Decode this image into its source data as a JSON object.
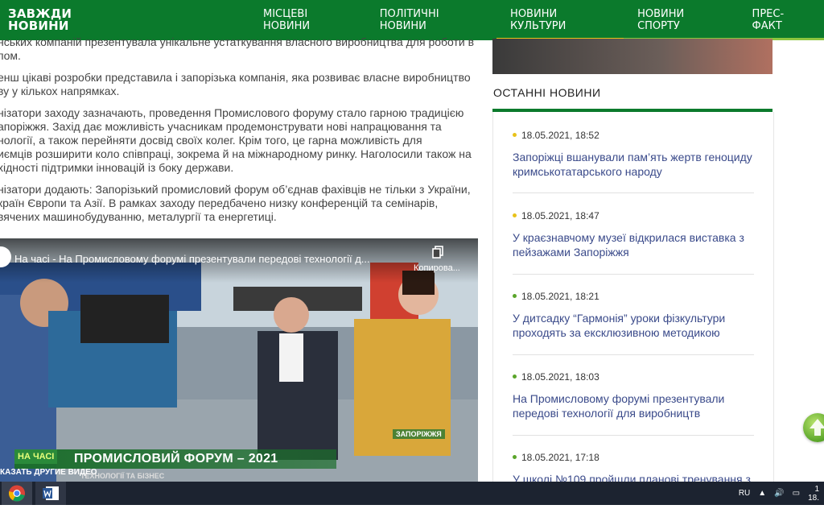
{
  "header": {
    "logo_line1": "ЗАВЖДИ",
    "logo_line2": "НОВИНИ",
    "nav": [
      {
        "label": "МІСЦЕВІ НОВИНИ",
        "bar_color": ""
      },
      {
        "label": "ПОЛІТИЧНІ НОВИНИ",
        "bar_color": ""
      },
      {
        "label": "НОВИНИ КУЛЬТУРИ",
        "bar_color": "#e8c21a"
      },
      {
        "label": "НОВИНИ СПОРТУ",
        "bar_color": "#8cc63f"
      },
      {
        "label": "ПРЕС-ФАКТ",
        "bar_color": "#8cc63f"
      }
    ],
    "bg_color": "#0b7a2c"
  },
  "article": {
    "paragraphs": [
      "нських компаній презентувала унікальне устаткування власного виробництва для роботи в\nпом.",
      "енш цікаві розробки представила і запорізька компанія, яка розвиває власне виробництво\nву у кількох напрямках.",
      "нізатори заходу зазначають, проведення Промислового форуму стало гарною традицією\nапоріжжя. Захід дає можливість учасникам продемонструвати нові напрацювання та\nнології, а також перейняти досвід своїх колег. Крім того, це гарна можливість для\nиємців розширити коло співпраці, зокрема й на міжнародному ринку. Наголосили також на\nхідності підтримки інновацій із боку держави.",
      "нізатори додають: Запорізький промисловий форум об’єднав фахівців не тільки з України,\nкраїн Європи та Азії. В рамках заходу передбачено низку конференцій та семінарів,\nвячених машинобудуванню, металургії та енергетиці."
    ]
  },
  "video": {
    "title": "На часі - На Промисловому форумі презентували передові технології д...",
    "copy_label": "Копирова...",
    "na_chasi": "НА ЧАСІ",
    "forum_title": "ПРОМИСЛОВИЙ ФОРУМ – 2021",
    "sub": "ТЕХНОЛОГІЇ ТА БІЗНЕС",
    "location": "ЗАПОРІЖЖЯ",
    "show_other": "КАЗАТЬ ДРУГИЕ ВИДЕО"
  },
  "sidebar": {
    "latest_title": "ОСТАННІ НОВИНИ",
    "news": [
      {
        "date": "18.05.2021, 18:52",
        "text": "Запоріжці вшанували пам’ять жертв геноциду кримськотатарського народу",
        "dot": "#e8c21a"
      },
      {
        "date": "18.05.2021, 18:47",
        "text": "У краєзнавчому музеї відкрилася виставка з пейзажами Запоріжжя",
        "dot": "#e8c21a"
      },
      {
        "date": "18.05.2021, 18:21",
        "text": "У дитсадку “Гармонія” уроки фізкультури проходять за ексклюзивною методикою",
        "dot": "#5aa52a"
      },
      {
        "date": "18.05.2021, 18:03",
        "text": "На Промисловому форумі презентували передові технології для виробництв",
        "dot": "#5aa52a"
      },
      {
        "date": "18.05.2021, 17:18",
        "text": "У школі №109 пройшли планові тренування з",
        "dot": "#5aa52a"
      }
    ]
  },
  "taskbar": {
    "lang": "RU",
    "time": "1",
    "date": "18."
  }
}
